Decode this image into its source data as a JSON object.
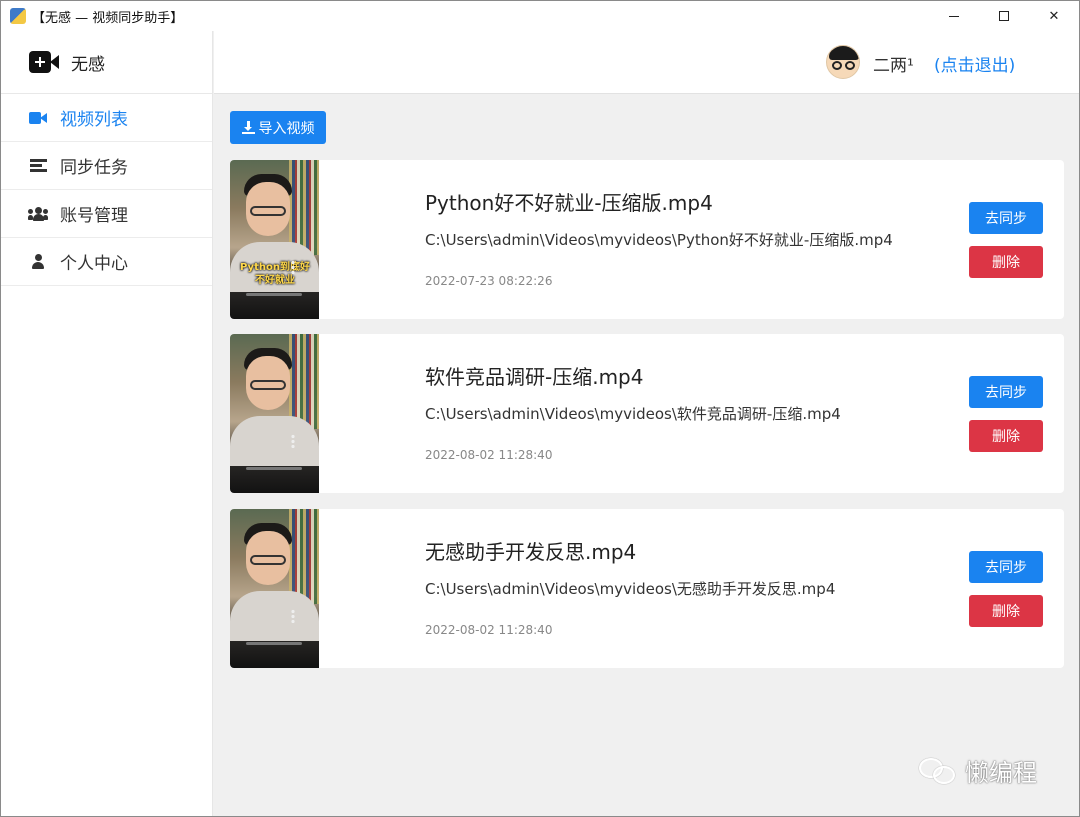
{
  "window": {
    "title": "【无感 — 视频同步助手】"
  },
  "sidebar": {
    "brand_name": "无感",
    "items": [
      {
        "label": "视频列表",
        "icon": "video-icon",
        "active": true
      },
      {
        "label": "同步任务",
        "icon": "tasks-icon",
        "active": false
      },
      {
        "label": "账号管理",
        "icon": "users-icon",
        "active": false
      },
      {
        "label": "个人中心",
        "icon": "user-icon",
        "active": false
      }
    ]
  },
  "header": {
    "username": "二两¹",
    "logout_label": "(点击退出)"
  },
  "toolbar": {
    "import_label": "导入视频"
  },
  "videos": [
    {
      "title": "Python好不好就业-压缩版.mp4",
      "path": "C:\\Users\\admin\\Videos\\myvideos\\Python好不好就业-压缩版.mp4",
      "date": "2022-07-23 08:22:26",
      "caption": "Python到底好不好就业",
      "sync_label": "去同步",
      "delete_label": "删除"
    },
    {
      "title": "软件竞品调研-压缩.mp4",
      "path": "C:\\Users\\admin\\Videos\\myvideos\\软件竞品调研-压缩.mp4",
      "date": "2022-08-02 11:28:40",
      "sync_label": "去同步",
      "delete_label": "删除"
    },
    {
      "title": "无感助手开发反思.mp4",
      "path": "C:\\Users\\admin\\Videos\\myvideos\\无感助手开发反思.mp4",
      "date": "2022-08-02 11:28:40",
      "sync_label": "去同步",
      "delete_label": "删除"
    }
  ],
  "watermark": {
    "text": "懒编程"
  },
  "colors": {
    "accent": "#1a83f0",
    "danger": "#dc3545",
    "background": "#f0f0f0"
  }
}
